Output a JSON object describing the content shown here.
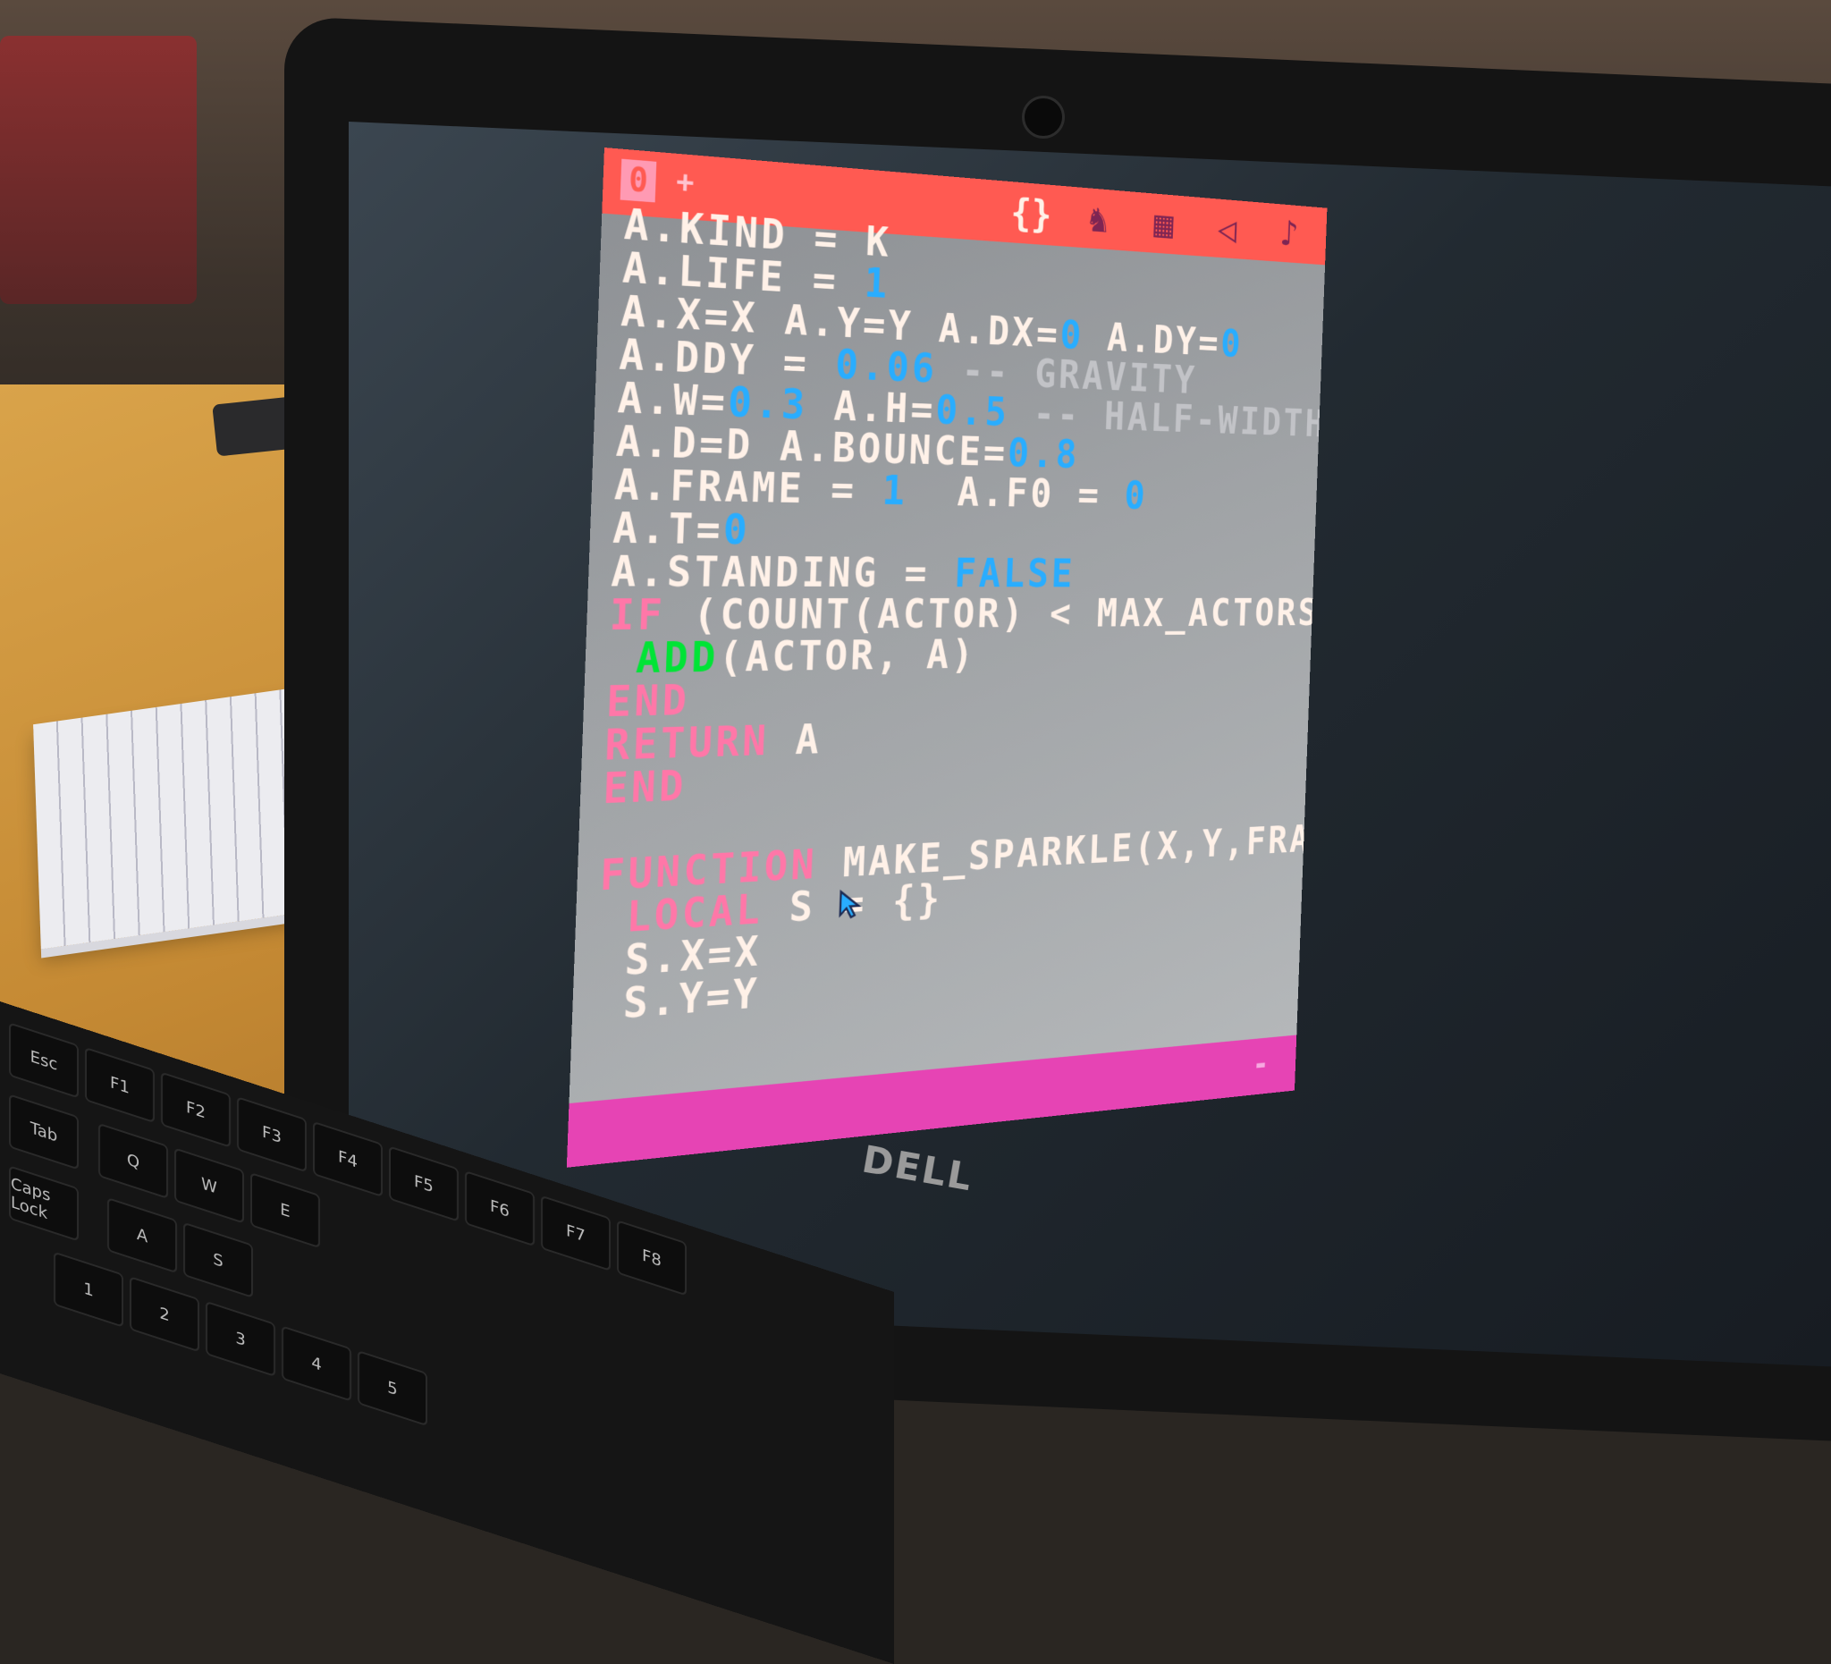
{
  "app": {
    "tab_label": "0",
    "add_tab_label": "+",
    "editor_tabs": [
      {
        "icon": "code-icon",
        "glyph": "{}",
        "active": true
      },
      {
        "icon": "sprite-icon",
        "glyph": "♞",
        "active": false
      },
      {
        "icon": "map-icon",
        "glyph": "▦",
        "active": false
      },
      {
        "icon": "sfx-icon",
        "glyph": "◁",
        "active": false
      },
      {
        "icon": "music-icon",
        "glyph": "♪",
        "active": false
      }
    ]
  },
  "code_lines": [
    [
      {
        "t": "A.KIND = K",
        "c": "t-id"
      }
    ],
    [
      {
        "t": "A.LIFE = ",
        "c": "t-id"
      },
      {
        "t": "1",
        "c": "t-num"
      }
    ],
    [
      {
        "t": "A.X=X A.Y=Y A.DX=",
        "c": "t-id"
      },
      {
        "t": "0",
        "c": "t-num"
      },
      {
        "t": " A.DY=",
        "c": "t-id"
      },
      {
        "t": "0",
        "c": "t-num"
      }
    ],
    [
      {
        "t": "A.DDY = ",
        "c": "t-id"
      },
      {
        "t": "0.06",
        "c": "t-num"
      },
      {
        "t": " -- GRAVITY",
        "c": "t-cm"
      }
    ],
    [
      {
        "t": "A.W=",
        "c": "t-id"
      },
      {
        "t": "0.3",
        "c": "t-num"
      },
      {
        "t": " A.H=",
        "c": "t-id"
      },
      {
        "t": "0.5",
        "c": "t-num"
      },
      {
        "t": " -- HALF-WIDTH",
        "c": "t-cm"
      }
    ],
    [
      {
        "t": "A.D=D A.BOUNCE=",
        "c": "t-id"
      },
      {
        "t": "0.8",
        "c": "t-num"
      }
    ],
    [
      {
        "t": "A.FRAME = ",
        "c": "t-id"
      },
      {
        "t": "1",
        "c": "t-num"
      },
      {
        "t": "  A.F0 = ",
        "c": "t-id"
      },
      {
        "t": "0",
        "c": "t-num"
      }
    ],
    [
      {
        "t": "A.T=",
        "c": "t-id"
      },
      {
        "t": "0",
        "c": "t-num"
      }
    ],
    [
      {
        "t": "A.STANDING = ",
        "c": "t-id"
      },
      {
        "t": "FALSE",
        "c": "t-num"
      }
    ],
    [
      {
        "t": "IF",
        "c": "t-kw"
      },
      {
        "t": " (COUNT(ACTOR) < MAX_ACTORS)",
        "c": "t-id"
      }
    ],
    [
      {
        "t": " ",
        "c": "t-id"
      },
      {
        "t": "ADD",
        "c": "t-api"
      },
      {
        "t": "(ACTOR, A)",
        "c": "t-id"
      }
    ],
    [
      {
        "t": "END",
        "c": "t-kw"
      }
    ],
    [
      {
        "t": "RETURN",
        "c": "t-kw"
      },
      {
        "t": " A",
        "c": "t-id"
      }
    ],
    [
      {
        "t": "END",
        "c": "t-kw"
      }
    ],
    [
      {
        "t": "",
        "c": "t-id"
      }
    ],
    [
      {
        "t": "FUNCTION",
        "c": "t-kw"
      },
      {
        "t": " MAKE_SPARKLE(X,Y,FRAME,",
        "c": "t-id"
      }
    ],
    [
      {
        "t": " LOCAL",
        "c": "t-kw"
      },
      {
        "t": " S = {}",
        "c": "t-id"
      }
    ],
    [
      {
        "t": " S.X=X",
        "c": "t-id"
      }
    ],
    [
      {
        "t": " S.Y=Y",
        "c": "t-id"
      }
    ]
  ],
  "status": {
    "text": "",
    "cursor_marker": "-"
  },
  "hardware": {
    "brand": "DELL",
    "keys": [
      "Esc",
      "F1",
      "F2",
      "F3",
      "F4",
      "F5",
      "F6",
      "F7",
      "F8",
      "Tab",
      "Q",
      "W",
      "E",
      "Caps Lock",
      "A",
      "S",
      "1",
      "2",
      "3",
      "4",
      "5"
    ]
  },
  "colors": {
    "topbar": "#ff5a52",
    "bottombar": "#e644b4",
    "keyword": "#ff77a8",
    "number": "#29adff",
    "comment": "#c2c3c7",
    "api": "#00e436"
  }
}
